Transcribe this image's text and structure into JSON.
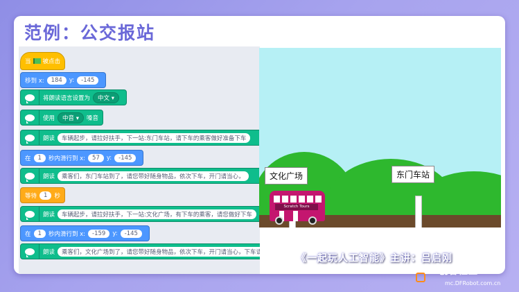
{
  "slide": {
    "title": "范例：公交报站",
    "credit": "《一起玩人工智能》主讲：吕启刚",
    "brand": "DF创客社区",
    "url": "mc.DFRobot.com.cn"
  },
  "blocks": [
    {
      "label": "当 被点击"
    },
    {
      "pre": "移到 x:",
      "v1": "184",
      "mid": "y:",
      "v2": "-145"
    },
    {
      "pre": "将朗读语言设置为",
      "drop": "中文"
    },
    {
      "pre": "使用",
      "drop": "中音",
      "post": "嗓音"
    },
    {
      "pre": "朗读",
      "text": "车辆起步，请拉好扶手，下一站:东门车站，请下车的乘客做好准备下车"
    },
    {
      "pre": "在",
      "v1": "1",
      "mid": "秒内滑行到 x:",
      "v2": "57",
      "mid2": "y:",
      "v3": "-145"
    },
    {
      "pre": "朗读",
      "text": "乘客们，东门车站到了，请您带好随身物品，依次下车，开门请当心，"
    },
    {
      "pre": "等待",
      "v1": "1",
      "post": "秒"
    },
    {
      "pre": "朗读",
      "text": "车辆起步，请拉好扶手，下一站:文化广场，有下车的乘客，请您做好下车"
    },
    {
      "pre": "在",
      "v1": "1",
      "mid": "秒内滑行到 x:",
      "v2": "-159",
      "mid2": "y:",
      "v3": "-145"
    },
    {
      "pre": "朗读",
      "text": "乘客们，文化广场到了，请您带好随身物品，依次下车，开门请当心，下车请注意安全"
    }
  ],
  "stage": {
    "sign_left": "文化广场",
    "sign_right": "东门车站",
    "bus_label": "Scratch Tours"
  },
  "colors": {
    "motion": "#4c97ff",
    "tts": "#0fbd8c",
    "control": "#ffab19",
    "event": "#ffbf00",
    "title": "#6a68d8"
  }
}
